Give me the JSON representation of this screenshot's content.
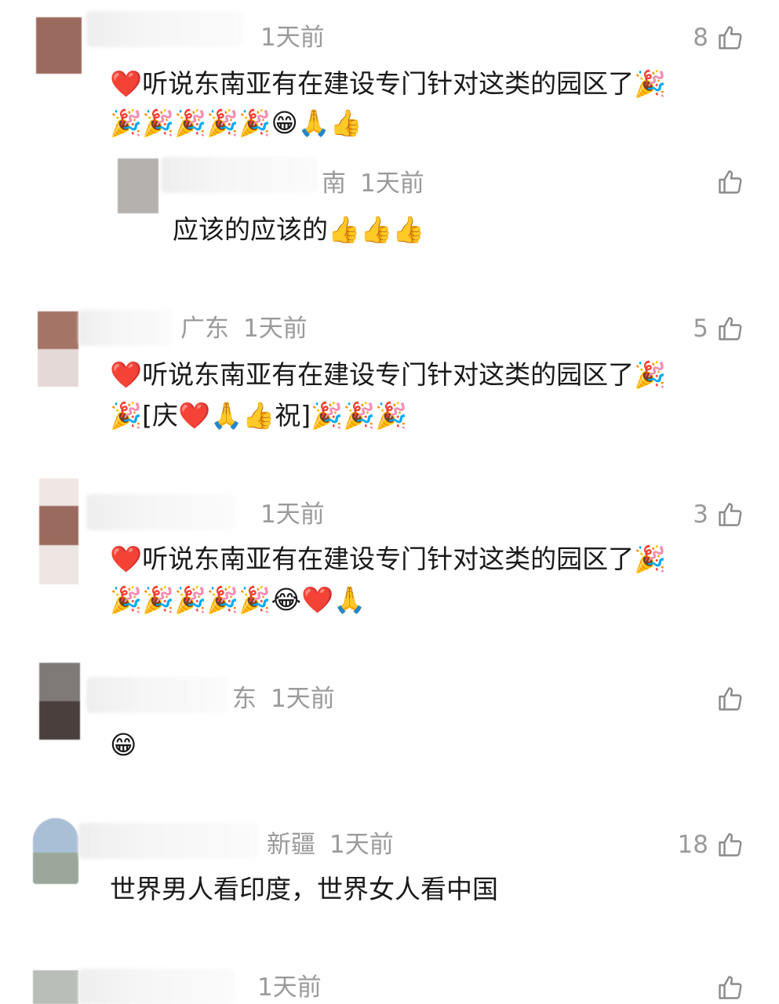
{
  "comments": [
    {
      "location": "",
      "time": "1天前",
      "likes": "8",
      "line1": "❤️听说东南亚有在建设专门针对这类的园区了🎉",
      "line2": "🎉🎉🎉🎉🎉😁🙏👍"
    },
    {
      "location": "南",
      "time": "1天前",
      "likes": "",
      "line1": "应该的应该的👍👍👍",
      "line2": ""
    },
    {
      "location": "广东",
      "time": "1天前",
      "likes": "5",
      "line1": "❤️听说东南亚有在建设专门针对这类的园区了🎉",
      "line2": "🎉[庆❤️🙏👍祝]🎉🎉🎉"
    },
    {
      "location": "",
      "time": "1天前",
      "likes": "3",
      "line1": "❤️听说东南亚有在建设专门针对这类的园区了🎉",
      "line2": "🎉🎉🎉🎉🎉😂❤️🙏"
    },
    {
      "location": "东",
      "time": "1天前",
      "likes": "",
      "line1": "😁",
      "line2": ""
    },
    {
      "location": "新疆",
      "time": "1天前",
      "likes": "18",
      "line1": "世界男人看印度，世界女人看中国",
      "line2": ""
    },
    {
      "location": "",
      "time": "1天前",
      "likes": "",
      "line1": "",
      "line2": ""
    }
  ]
}
